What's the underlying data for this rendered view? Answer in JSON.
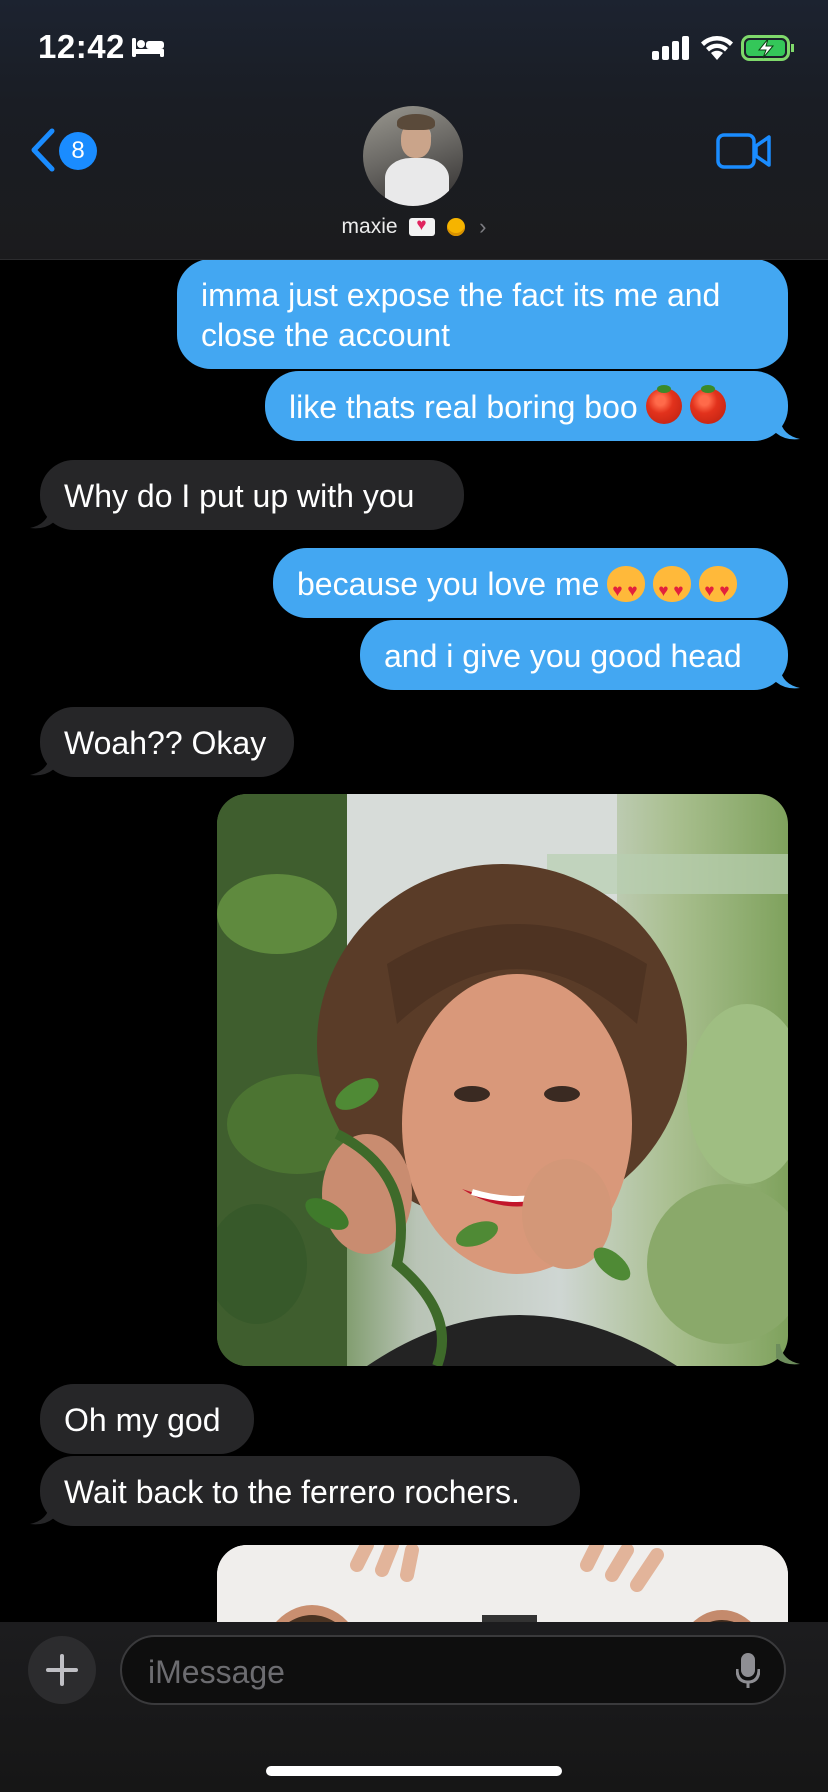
{
  "status_bar": {
    "time": "12:42",
    "icons": [
      "bed-icon",
      "cellular-signal-icon",
      "wifi-icon",
      "battery-charging-icon"
    ]
  },
  "header": {
    "back_badge_count": "8",
    "contact_name": "maxie",
    "name_icons": [
      "love-letter-icon",
      "medal-icon"
    ],
    "video_icon": "video-camera-icon",
    "accent_color": "#1a8cff"
  },
  "messages": [
    {
      "from": "me",
      "text": "imma just expose the fact its me and close the account"
    },
    {
      "from": "me",
      "text": "like thats real boring boo",
      "emoji": [
        "tomato",
        "tomato"
      ]
    },
    {
      "from": "them",
      "text": "Why do I put up with you"
    },
    {
      "from": "me",
      "text": "because you love me",
      "emoji": [
        "heart-eyes-cat",
        "heart-eyes-cat",
        "heart-eyes-cat"
      ]
    },
    {
      "from": "me",
      "text": "and i give you good head"
    },
    {
      "from": "them",
      "text": "Woah?? Okay"
    },
    {
      "from": "me",
      "type": "photo"
    },
    {
      "from": "them",
      "text": "Oh my god"
    },
    {
      "from": "them",
      "text": "Wait back to the ferrero rochers."
    },
    {
      "from": "me",
      "type": "photo"
    }
  ],
  "colors": {
    "outgoing_bubble": "#43a7f2",
    "incoming_bubble": "#262628",
    "background": "#000000"
  },
  "composer": {
    "placeholder": "iMessage",
    "value": ""
  }
}
